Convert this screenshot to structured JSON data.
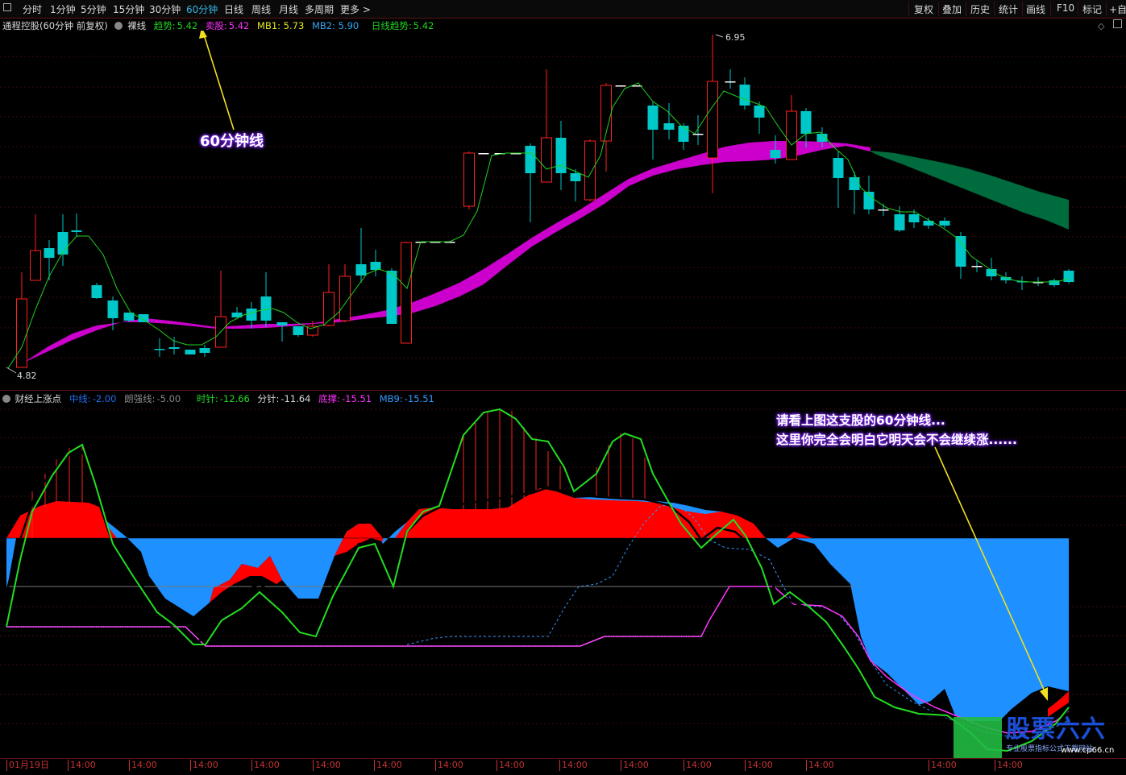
{
  "toolbar": {
    "left_items": [
      "分时",
      "1分钟",
      "5分钟",
      "15分钟",
      "30分钟",
      "60分钟",
      "日线",
      "周线",
      "月线",
      "多周期",
      "更多 >"
    ],
    "active_index": 5,
    "right_items": [
      "复权",
      "叠加",
      "历史",
      "统计",
      "画线",
      "F10",
      "标记",
      "+自选"
    ]
  },
  "main_legend": {
    "stock": "通程控股(60分钟 前复权)",
    "indicator": "裸线",
    "trend_label": "趋势:",
    "trend_value": "5.42",
    "sell_label": "卖股:",
    "sell_value": "5.42",
    "mb1": "MB1: 5.73",
    "mb2": "MB2: 5.90",
    "daily_trend_label": "日线趋势:",
    "daily_trend_value": "5.42"
  },
  "price_markers": {
    "high": "6.95",
    "low": "4.82"
  },
  "sub_legend": {
    "name": "财经上涨点",
    "mid_label": "中线:",
    "mid_value": "-2.00",
    "strong_label": "朗强线:",
    "strong_value": "-5.00",
    "hour_label": "时针:",
    "hour_value": "-12.66",
    "minute_label": "分针:",
    "minute_value": "-11.64",
    "bottom_label": "底撑:",
    "bottom_value": "-15.51",
    "mb9_label": "MB9:",
    "mb9_value": "-15.51"
  },
  "callouts": {
    "top": "60分钟线",
    "bottom_line1": "请看上图这支股的60分钟线...",
    "bottom_line2": "这里你完全会明白它明天会不会继续涨......"
  },
  "time_axis": [
    "01月19日",
    "14:00",
    "14:00",
    "14:00",
    "14:00",
    "14:00",
    "14:00",
    "14:00",
    "14:00",
    "14:00",
    "14:00",
    "14:00",
    "14:00",
    "14:00",
    "14:00",
    "14:00"
  ],
  "watermark": {
    "title": "股票六六",
    "site": "www.cp66.cn",
    "tagline": "专业股票指标公式下载网站"
  },
  "colors": {
    "up": "#ff2020",
    "down": "#00c8c8",
    "ma_line": "#20d020",
    "ribbon_up": "#cc00cc",
    "ribbon_down": "#006b3c",
    "sub_red": "#ff0000",
    "sub_blue": "#1e90ff",
    "hour_line": "#22dd22",
    "bottom_line": "#ff33ff",
    "mb9_line": "#3399ff",
    "active_tab": "#36b5e8"
  }
}
